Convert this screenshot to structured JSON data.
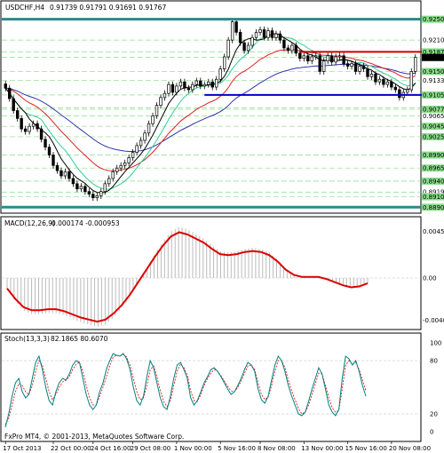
{
  "header": {
    "symbol_tf": "USDCHF,H4",
    "ohlc": "0.91739 0.91791 0.91691 0.91767"
  },
  "footer": {
    "copyright": "FxPro MT4, © 2001-2013, MetaQuotes Software Corp."
  },
  "colors": {
    "background": "#ffffff",
    "candles": "#000000",
    "support_resistance_teal": "#2a8a8a",
    "resistance_red": "#cc0000",
    "support_blue": "#0000cc",
    "ma_black": "#000000",
    "ma_green": "#33cc99",
    "ma_red": "#dd2222",
    "ma_blue": "#3333aa",
    "grid_green": "#88dd88",
    "macd_line": "#dd0000",
    "histogram": "#bbbbbb",
    "stoch_main": "#008080",
    "stoch_signal": "#dd0000",
    "price_tag": "#000000"
  },
  "chart_data": [
    {
      "type": "candlestick",
      "title": "USDCHF,H4",
      "ylim": [
        0.8882,
        0.9263
      ],
      "price_labels": [
        "0.92500",
        "0.92100",
        "0.91875",
        "0.91767",
        "0.91500",
        "0.91330",
        "0.91050",
        "0.90800",
        "0.90775",
        "0.90650",
        "0.90450",
        "0.90250",
        "0.89900",
        "0.89650",
        "0.89400",
        "0.89190",
        "0.89100",
        "0.88900"
      ],
      "highlighted_labels": [
        "0.92500",
        "0.91875",
        "0.91767",
        "0.91500",
        "0.91050",
        "0.90775",
        "0.90450",
        "0.90250",
        "0.89900",
        "0.89650",
        "0.89400",
        "0.89100",
        "0.88900"
      ],
      "horizontal_lines": [
        {
          "name": "teal-top",
          "value": 0.925
        },
        {
          "name": "teal-bottom",
          "value": 0.889
        },
        {
          "name": "red-resistance",
          "value": 0.91875,
          "from_bar": 74,
          "to_bar": 111
        },
        {
          "name": "blue-support",
          "value": 0.9105,
          "from_bar": 50,
          "to_bar": 111
        }
      ],
      "x_tick_labels": [
        "17 Oct 2013",
        "22 Oct 00:00",
        "24 Oct 16:00",
        "29 Oct 08:00",
        "1 Nov 00:00",
        "5 Nov 16:00",
        "8 Nov 08:00",
        "13 Nov 00:00",
        "15 Nov 16:00",
        "20 Nov 08:00"
      ],
      "x_tick_bars": [
        0,
        12,
        22,
        32,
        43,
        54,
        64,
        75,
        86,
        97
      ],
      "close": [
        0.9118,
        0.9098,
        0.9075,
        0.906,
        0.904,
        0.9035,
        0.9045,
        0.905,
        0.904,
        0.902,
        0.9005,
        0.899,
        0.897,
        0.896,
        0.895,
        0.8958,
        0.8945,
        0.8935,
        0.8925,
        0.893,
        0.892,
        0.8915,
        0.8908,
        0.8912,
        0.892,
        0.8935,
        0.8945,
        0.8958,
        0.8965,
        0.897,
        0.8975,
        0.8985,
        0.8995,
        0.9008,
        0.9018,
        0.9032,
        0.905,
        0.9065,
        0.9085,
        0.91,
        0.9108,
        0.9125,
        0.911,
        0.9122,
        0.913,
        0.9118,
        0.9115,
        0.9125,
        0.9132,
        0.9122,
        0.9125,
        0.913,
        0.912,
        0.9135,
        0.9155,
        0.9178,
        0.921,
        0.9245,
        0.9225,
        0.9205,
        0.919,
        0.92,
        0.9215,
        0.9225,
        0.923,
        0.9215,
        0.9228,
        0.9215,
        0.9222,
        0.921,
        0.9195,
        0.919,
        0.92,
        0.9185,
        0.9175,
        0.918,
        0.917,
        0.9178,
        0.918,
        0.915,
        0.917,
        0.918,
        0.9168,
        0.9178,
        0.918,
        0.9165,
        0.916,
        0.9165,
        0.915,
        0.916,
        0.9155,
        0.914,
        0.9145,
        0.913,
        0.9135,
        0.9125,
        0.913,
        0.912,
        0.9115,
        0.91,
        0.911,
        0.9115,
        0.915,
        0.9177
      ]
    },
    {
      "type": "line",
      "title": "MACD(12,26,9)",
      "header_values": "0.000174 -0.000953",
      "ylim": [
        -0.0047,
        0.0047
      ],
      "tick_labels": [
        "0.004502",
        "0.00",
        "-0.004049"
      ],
      "series": [
        {
          "name": "Signal",
          "values": [
            -0.001,
            -0.002,
            -0.0028,
            -0.0031,
            -0.0031,
            -0.003,
            -0.003,
            -0.0032,
            -0.0035,
            -0.0038,
            -0.004,
            -0.0042,
            -0.004,
            -0.0034,
            -0.0026,
            -0.0016,
            -0.0004,
            0.0008,
            0.002,
            0.0031,
            0.004,
            0.0044,
            0.0042,
            0.0038,
            0.0034,
            0.0028,
            0.0023,
            0.0022,
            0.0023,
            0.0025,
            0.0026,
            0.0025,
            0.0022,
            0.0016,
            0.0008,
            0.0003,
            0.0001,
            0.0001,
            0.0001,
            -0.0001,
            -0.0004,
            -0.0007,
            -0.0009,
            -0.0008,
            -0.0005
          ]
        }
      ]
    },
    {
      "type": "line",
      "title": "Stoch(13,3,3)",
      "header_values": "82.1865 80.6070",
      "ylim": [
        0,
        100
      ],
      "tick_labels": [
        "100",
        "80",
        "20",
        "0"
      ],
      "series": [
        {
          "name": "Main",
          "values": [
            5,
            20,
            40,
            55,
            60,
            45,
            38,
            42,
            60,
            78,
            85,
            70,
            50,
            35,
            30,
            45,
            55,
            60,
            58,
            65,
            75,
            80,
            78,
            60,
            42,
            30,
            25,
            30,
            45,
            55,
            70,
            80,
            88,
            86,
            85,
            88,
            82,
            70,
            50,
            35,
            30,
            40,
            62,
            80,
            72,
            55,
            38,
            28,
            25,
            40,
            60,
            75,
            78,
            70,
            60,
            38,
            30,
            35,
            45,
            55,
            62,
            70,
            72,
            68,
            62,
            55,
            48,
            42,
            45,
            52,
            60,
            70,
            78,
            75,
            68,
            48,
            36,
            32,
            40,
            58,
            75,
            85,
            80,
            68,
            52,
            40,
            30,
            20,
            18,
            22,
            34,
            48,
            60,
            72,
            65,
            48,
            30,
            22,
            18,
            25,
            60,
            85,
            82,
            75,
            80,
            68,
            52,
            40
          ]
        },
        {
          "name": "Signal",
          "values": [
            8,
            15,
            30,
            45,
            54,
            52,
            45,
            42,
            52,
            68,
            80,
            75,
            60,
            45,
            36,
            42,
            50,
            56,
            58,
            62,
            70,
            76,
            78,
            68,
            52,
            38,
            30,
            30,
            40,
            50,
            62,
            74,
            84,
            86,
            85,
            87,
            84,
            75,
            60,
            45,
            36,
            38,
            52,
            70,
            74,
            62,
            46,
            34,
            28,
            35,
            52,
            68,
            76,
            72,
            64,
            46,
            35,
            34,
            42,
            52,
            60,
            66,
            70,
            68,
            63,
            57,
            51,
            46,
            45,
            50,
            57,
            66,
            74,
            75,
            70,
            55,
            42,
            36,
            39,
            52,
            68,
            80,
            80,
            72,
            58,
            46,
            36,
            26,
            20,
            22,
            30,
            42,
            54,
            66,
            65,
            52,
            38,
            27,
            22,
            24,
            48,
            75,
            80,
            76,
            78,
            70,
            58,
            46
          ]
        }
      ]
    }
  ]
}
